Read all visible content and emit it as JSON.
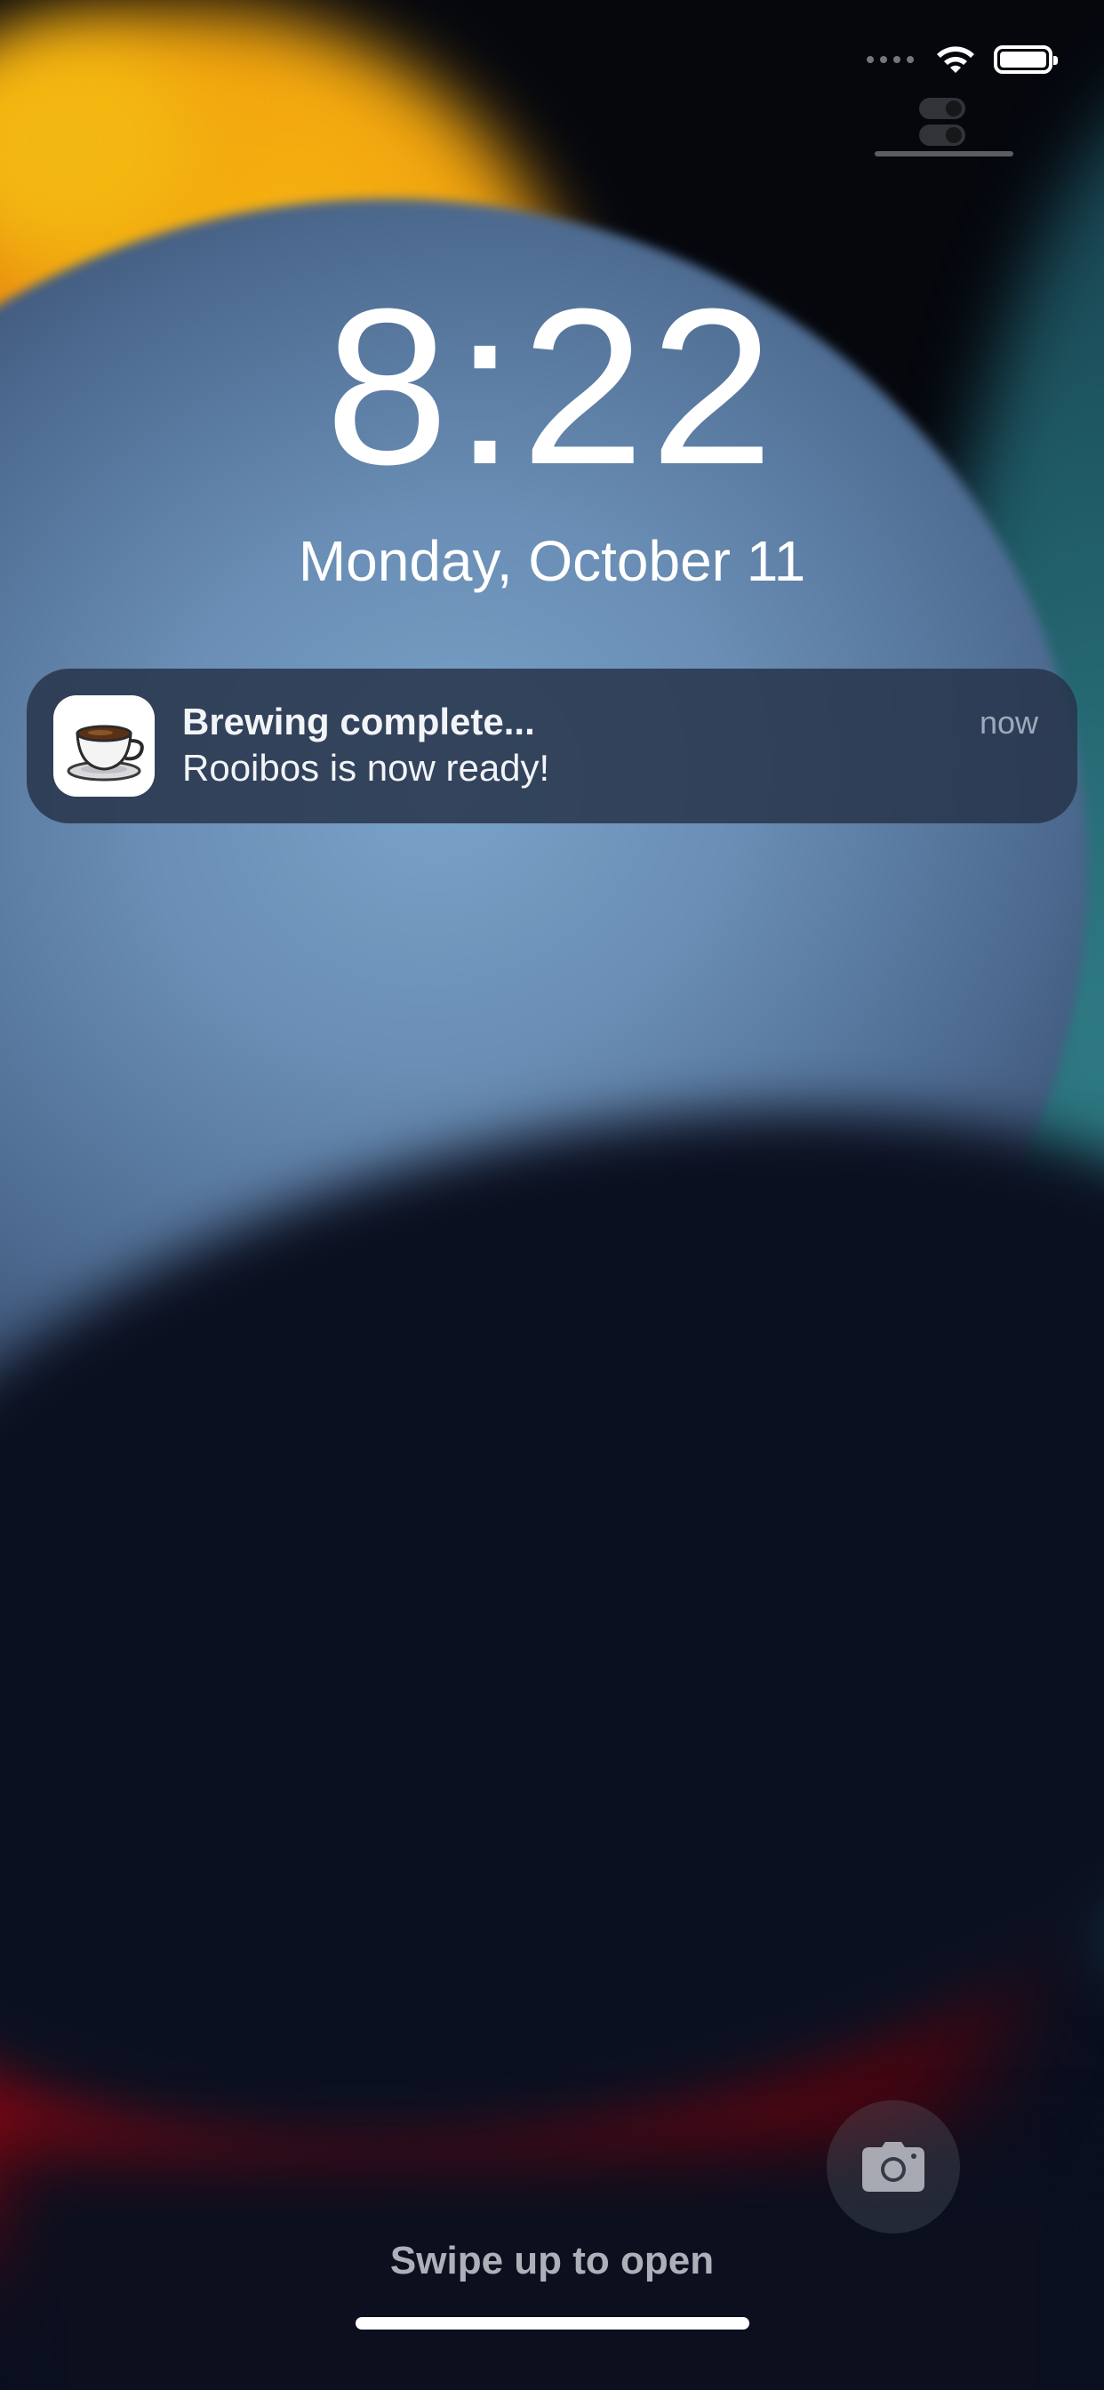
{
  "status_bar": {
    "cellular": "cellular-signal-icon",
    "wifi": "wifi-icon",
    "battery": "battery-icon",
    "battery_level": 1.0
  },
  "lock_screen": {
    "time": "8:22",
    "date": "Monday, October 11"
  },
  "notification": {
    "app_icon": "coffee-cup-icon",
    "title": "Brewing complete...",
    "body": "Rooibos is now ready!",
    "timestamp": "now"
  },
  "camera": {
    "icon": "camera-icon"
  },
  "footer": {
    "swipe_hint": "Swipe up to open"
  },
  "colors": {
    "orange": "#f0a10e",
    "blue": "#6a8eb5",
    "teal": "#1f5b66",
    "red": "#7a0612",
    "notification_bg": "#28344a"
  }
}
